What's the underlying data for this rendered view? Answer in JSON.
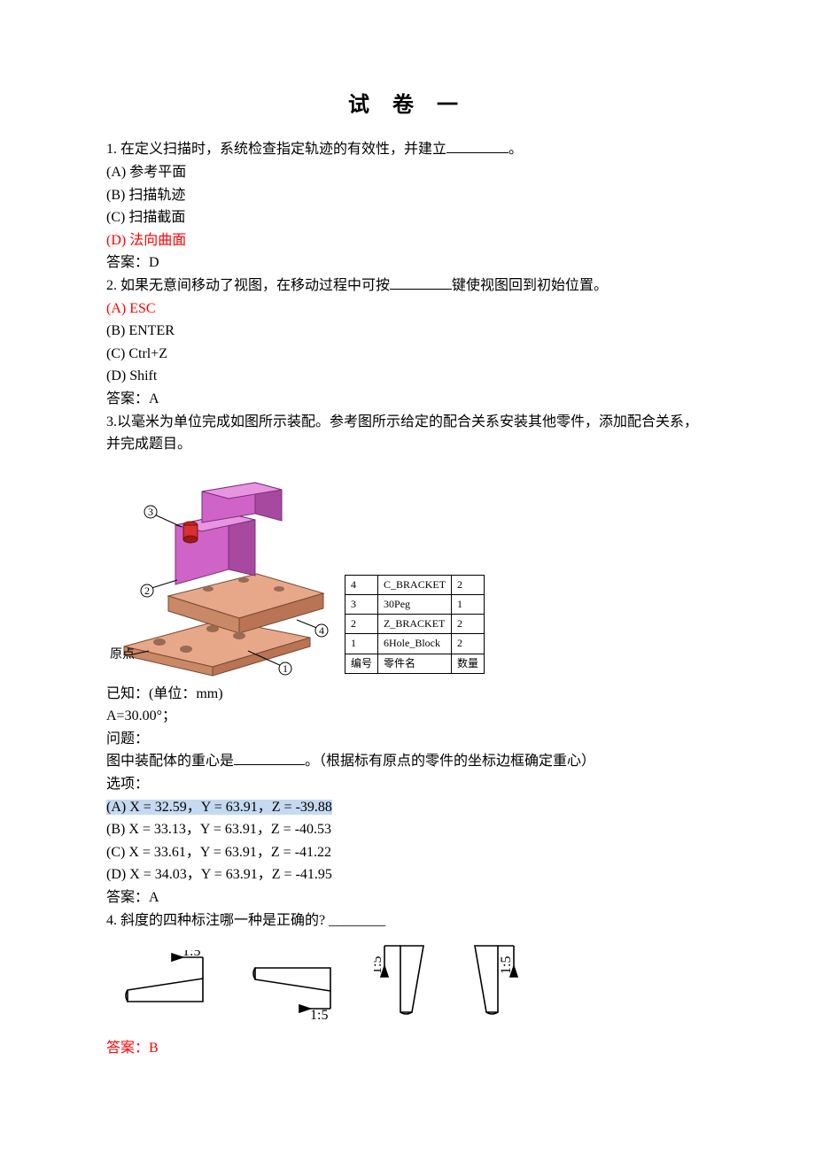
{
  "title": "试 卷 一",
  "q1": {
    "prompt_before": "1. 在定义扫描时，系统检查指定轨迹的有效性，并建立",
    "prompt_after": "。",
    "optA": "(A) 参考平面",
    "optB": "(B) 扫描轨迹",
    "optC": "(C) 扫描截面",
    "optD": "(D) 法向曲面",
    "answer": "答案：D"
  },
  "q2": {
    "prompt_before": "2.  如果无意间移动了视图，在移动过程中可按",
    "prompt_after": "键使视图回到初始位置。",
    "optA": "(A)    ESC",
    "optB": "(B)    ENTER",
    "optC": "(C)    Ctrl+Z",
    "optD": "(D)    Shift",
    "answer": "答案：A"
  },
  "q3": {
    "prompt": "3.以毫米为单位完成如图所示装配。参考图所示给定的配合关系安装其他零件，添加配合关系，并完成题目。",
    "origin_label": "原点",
    "parts_table": {
      "rows": [
        {
          "no": "4",
          "name": "C_BRACKET",
          "qty": "2"
        },
        {
          "no": "3",
          "name": "30Peg",
          "qty": "1"
        },
        {
          "no": "2",
          "name": "Z_BRACKET",
          "qty": "2"
        },
        {
          "no": "1",
          "name": "6Hole_Block",
          "qty": "2"
        }
      ],
      "header": {
        "no": "编号",
        "name": "零件名",
        "qty": "数量"
      }
    },
    "known": "已知：(单位：mm)",
    "A": "A=30.00°；",
    "question_label": "问题：",
    "question_before": "图中装配体的重心是",
    "question_after": "。（根据标有原点的零件的坐标边框确定重心）",
    "options_label": "选项：",
    "optA": "(A)  X = 32.59，Y = 63.91，Z = -39.88",
    "optB": "(B)  X = 33.13，Y = 63.91，Z = -40.53",
    "optC": "(C)  X = 33.61，Y = 63.91，Z = -41.22",
    "optD": "(D)  X = 34.03，Y = 63.91，Z = -41.95",
    "answer": "答案：A"
  },
  "q4": {
    "prompt": "4.  斜度的四种标注哪一种是正确的? ________",
    "ratio": "1:5",
    "answer": "答案：B"
  }
}
